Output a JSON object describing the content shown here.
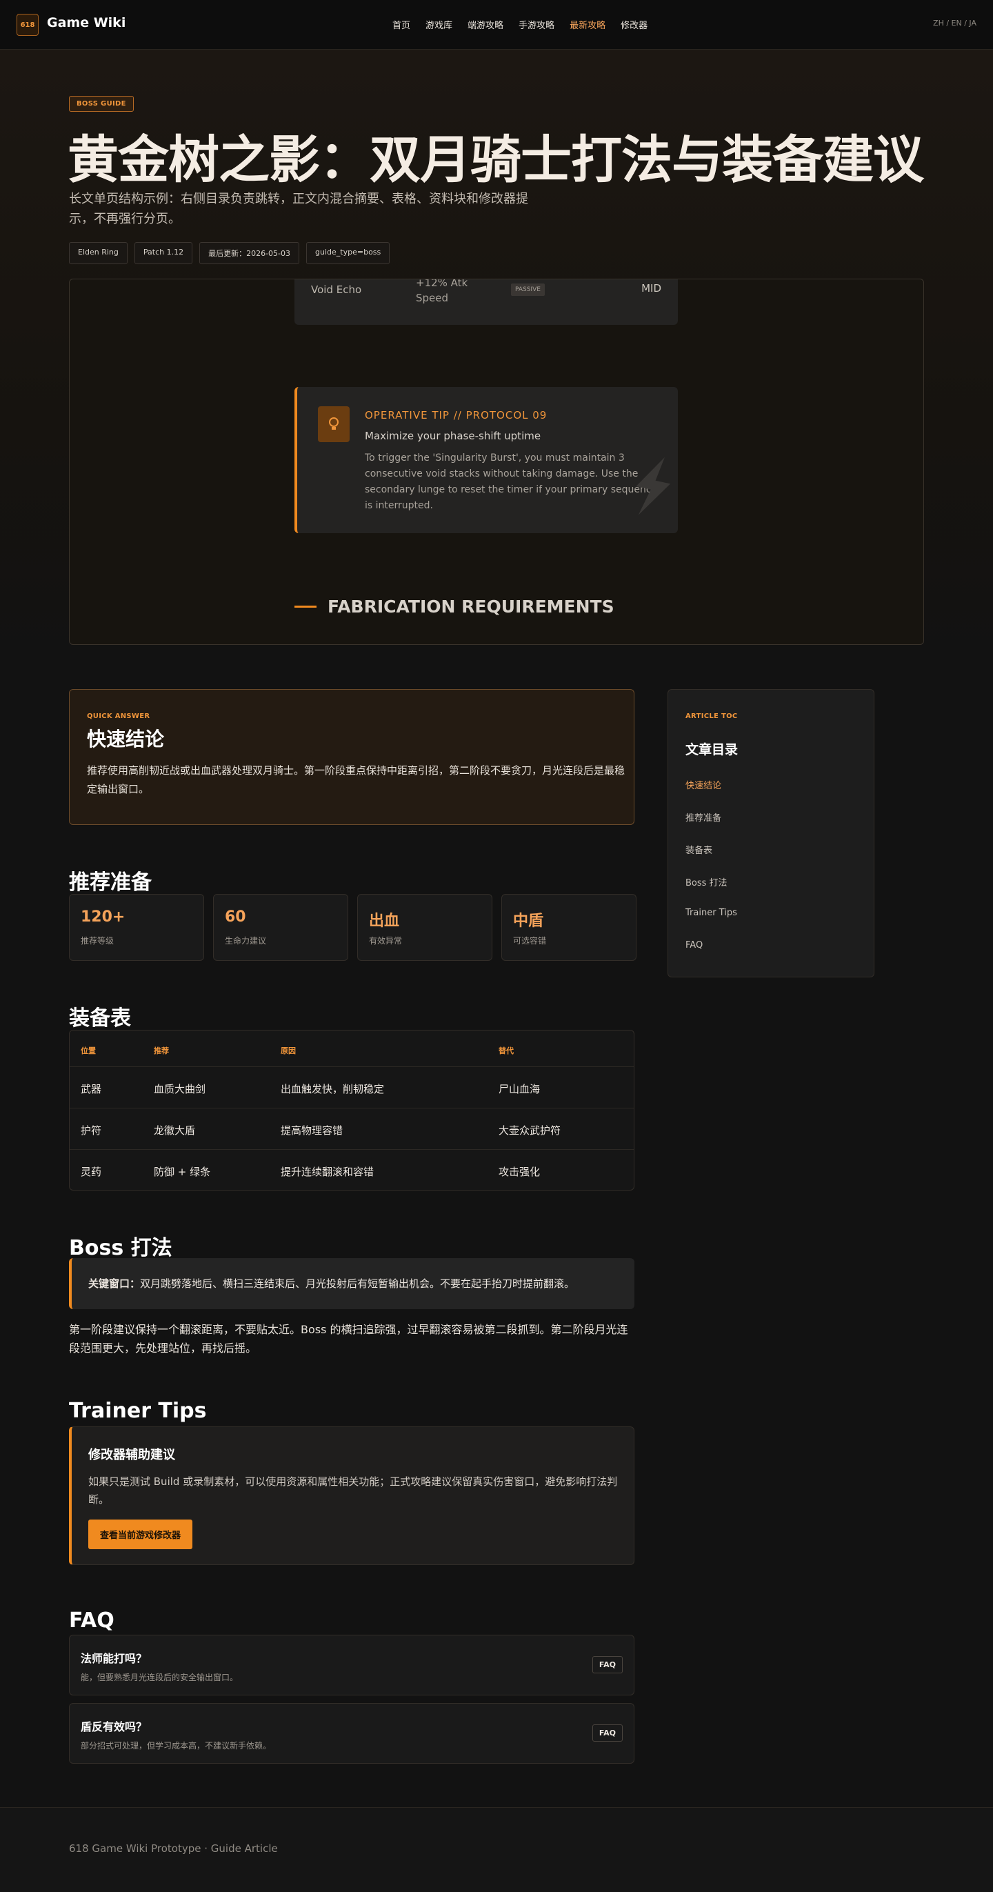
{
  "header": {
    "logo_text": "618",
    "site_name": "Game Wiki",
    "nav": [
      "首页",
      "游戏库",
      "端游攻略",
      "手游攻略",
      "最新攻略",
      "修改器"
    ],
    "active_nav": "最新攻略",
    "langs": "ZH / EN / JA"
  },
  "hero": {
    "badge": "BOSS GUIDE",
    "title": "黄金树之影：双月骑士打法与装备建议",
    "subtitle": "长文单页结构示例：右侧目录负责跳转，正文内混合摘要、表格、资料块和修改器提示，不再强行分页。",
    "tags": [
      "Elden Ring",
      "Patch 1.12",
      "最后更新：2026-05-03",
      "guide_type=boss"
    ]
  },
  "preview": {
    "row": {
      "name": "Void Echo",
      "effect": "+12% Atk Speed",
      "type": "PASSIVE",
      "tier": "MID"
    },
    "tip": {
      "head": "OPERATIVE TIP // PROTOCOL 09",
      "sub": "Maximize your phase-shift uptime",
      "body": "To trigger the 'Singularity Burst', you must maintain 3 consecutive void stacks without taking damage. Use the secondary lunge to reset the timer if your primary sequence is interrupted."
    },
    "fab_heading": "FABRICATION REQUIREMENTS"
  },
  "quick": {
    "eyebrow": "QUICK ANSWER",
    "title": "快速结论",
    "body": "推荐使用高削韧近战或出血武器处理双月骑士。第一阶段重点保持中距离引招，第二阶段不要贪刀，月光连段后是最稳定输出窗口。"
  },
  "toc": {
    "eyebrow": "ARTICLE TOC",
    "title": "文章目录",
    "items": [
      "快速结论",
      "推荐准备",
      "装备表",
      "Boss 打法",
      "Trainer Tips",
      "FAQ"
    ]
  },
  "prep": {
    "heading": "推荐准备",
    "stats": [
      {
        "value": "120+",
        "label": "推荐等级"
      },
      {
        "value": "60",
        "label": "生命力建议"
      },
      {
        "value": "出血",
        "label": "有效异常"
      },
      {
        "value": "中盾",
        "label": "可选容错"
      }
    ]
  },
  "equip": {
    "heading": "装备表",
    "columns": [
      "位置",
      "推荐",
      "原因",
      "替代"
    ],
    "rows": [
      [
        "武器",
        "血质大曲剑",
        "出血触发快，削韧稳定",
        "尸山血海"
      ],
      [
        "护符",
        "龙徽大盾",
        "提高物理容错",
        "大壶众武护符"
      ],
      [
        "灵药",
        "防御 + 绿条",
        "提升连续翻滚和容错",
        "攻击强化"
      ]
    ]
  },
  "boss": {
    "heading": "Boss 打法",
    "callout_label": "关键窗口：",
    "callout_text": "双月跳劈落地后、横扫三连结束后、月光投射后有短暂输出机会。不要在起手抬刀时提前翻滚。",
    "para": "第一阶段建议保持一个翻滚距离，不要贴太近。Boss 的横扫追踪强，过早翻滚容易被第二段抓到。第二阶段月光连段范围更大，先处理站位，再找后摇。"
  },
  "trainer": {
    "heading": "Trainer Tips",
    "card_title": "修改器辅助建议",
    "card_body": "如果只是测试 Build 或录制素材，可以使用资源和属性相关功能；正式攻略建议保留真实伤害窗口，避免影响打法判断。",
    "button": "查看当前游戏修改器"
  },
  "faq": {
    "heading": "FAQ",
    "items": [
      {
        "q": "法师能打吗？",
        "a": "能，但要熟悉月光连段后的安全输出窗口。",
        "badge": "FAQ"
      },
      {
        "q": "盾反有效吗？",
        "a": "部分招式可处理，但学习成本高，不建议新手依赖。",
        "badge": "FAQ"
      }
    ]
  },
  "footer": {
    "text": "618 Game Wiki Prototype · Guide Article"
  }
}
